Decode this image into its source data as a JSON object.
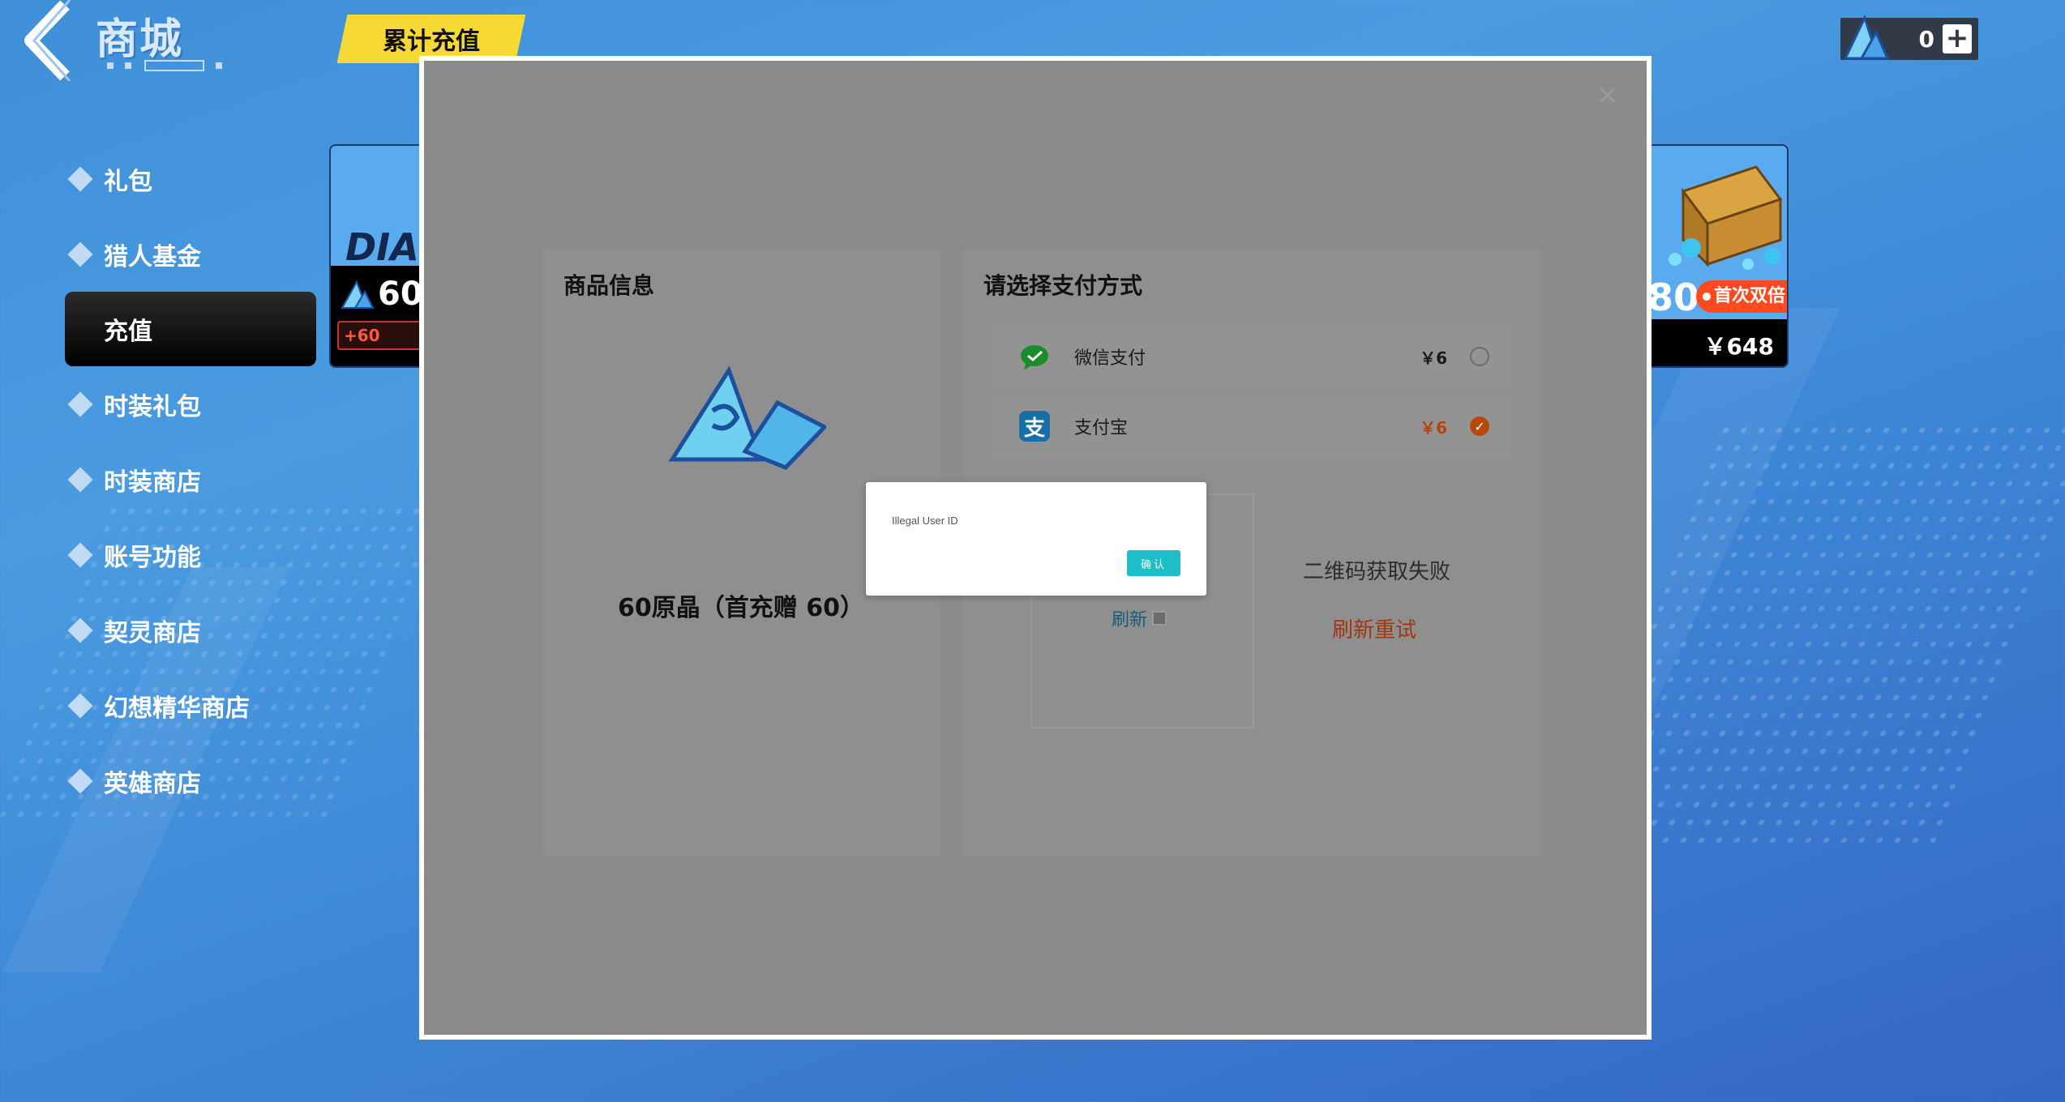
{
  "header": {
    "title": "商城",
    "cumulative_tab": "累计充值",
    "currency_amount": "0",
    "currency_plus": "+"
  },
  "sidebar": {
    "items": [
      {
        "label": "礼包"
      },
      {
        "label": "猎人基金"
      },
      {
        "label": "充值",
        "active": true
      },
      {
        "label": "时装礼包"
      },
      {
        "label": "时装商店"
      },
      {
        "label": "账号功能"
      },
      {
        "label": "契灵商店"
      },
      {
        "label": "幻想精华商店"
      },
      {
        "label": "英雄商店"
      }
    ]
  },
  "cards": {
    "left": {
      "brand": "DIA",
      "amount": "60",
      "bonus": "+60"
    },
    "right": {
      "amount": "80",
      "badge": "首次双倍",
      "price": "￥648"
    }
  },
  "payment": {
    "close": "×",
    "product_panel_title": "商品信息",
    "product_name": "60原晶（首充赠 60）",
    "pay_panel_title": "请选择支付方式",
    "methods": [
      {
        "label": "微信支付",
        "price": "￥6",
        "selected": false
      },
      {
        "label": "支付宝",
        "price": "￥6",
        "selected": true
      }
    ],
    "qr_refresh": "刷新",
    "qr_fail": "二维码获取失败",
    "qr_retry": "刷新重试"
  },
  "alert": {
    "message": "Illegal User ID",
    "confirm": "确认"
  },
  "colors": {
    "accent_yellow": "#f7d935",
    "confirm_teal": "#1ebec8",
    "price_orange": "#b8430a",
    "badge_red": "#ff4a1f"
  }
}
